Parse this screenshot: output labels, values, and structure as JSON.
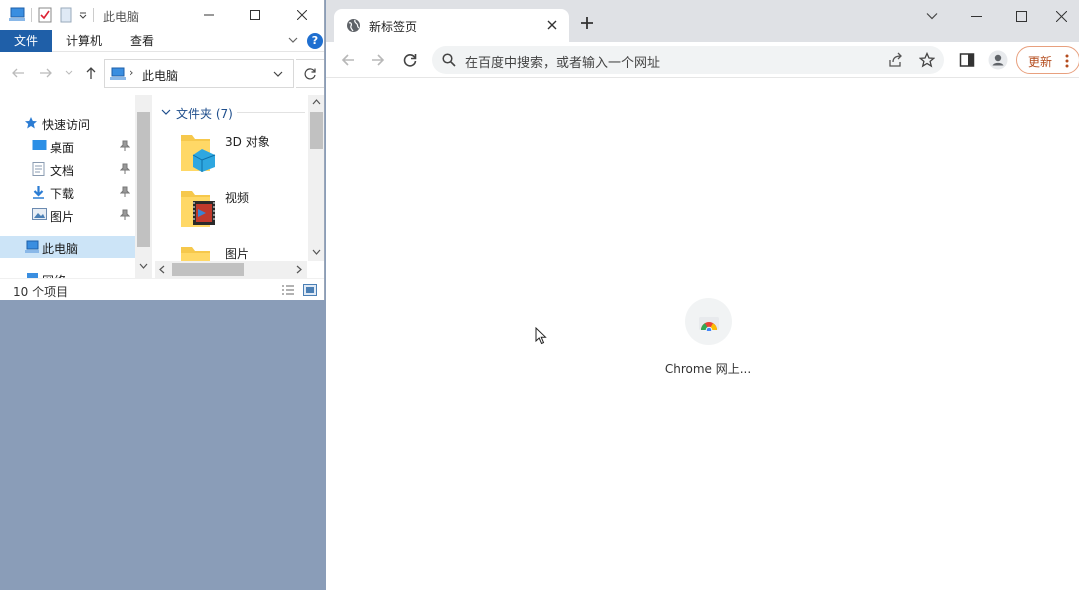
{
  "explorer": {
    "title": "此电脑",
    "ribbon_tabs": [
      "文件",
      "计算机",
      "查看"
    ],
    "help_label": "?",
    "address_text": "此电脑",
    "address_separator": "›",
    "nav": {
      "quick_access": "快速访问",
      "items": [
        {
          "label": "桌面",
          "icon": "desktop-icon",
          "pinned": true
        },
        {
          "label": "文档",
          "icon": "documents-icon",
          "pinned": true
        },
        {
          "label": "下载",
          "icon": "download-icon",
          "pinned": true
        },
        {
          "label": "图片",
          "icon": "pictures-icon",
          "pinned": true
        }
      ],
      "this_pc": "此电脑",
      "network": "网络"
    },
    "content": {
      "group_header": "文件夹 (7)",
      "folders": [
        {
          "label": "3D 对象",
          "icon": "3d-objects-folder-icon"
        },
        {
          "label": "视频",
          "icon": "videos-folder-icon"
        },
        {
          "label": "图片",
          "icon": "pictures-folder-icon"
        }
      ]
    },
    "status": "10 个项目"
  },
  "chrome": {
    "tab_title": "新标签页",
    "omnibox_placeholder": "在百度中搜索，或者输入一个网址",
    "update_label": "更新",
    "shortcut_label": "Chrome 网上...",
    "colors": {
      "tabstrip": "#dfe1e5",
      "update_accent": "#b44c1e",
      "desktop_bg": "#8a9db8",
      "explorer_file_tab": "#1f5fa8"
    }
  }
}
